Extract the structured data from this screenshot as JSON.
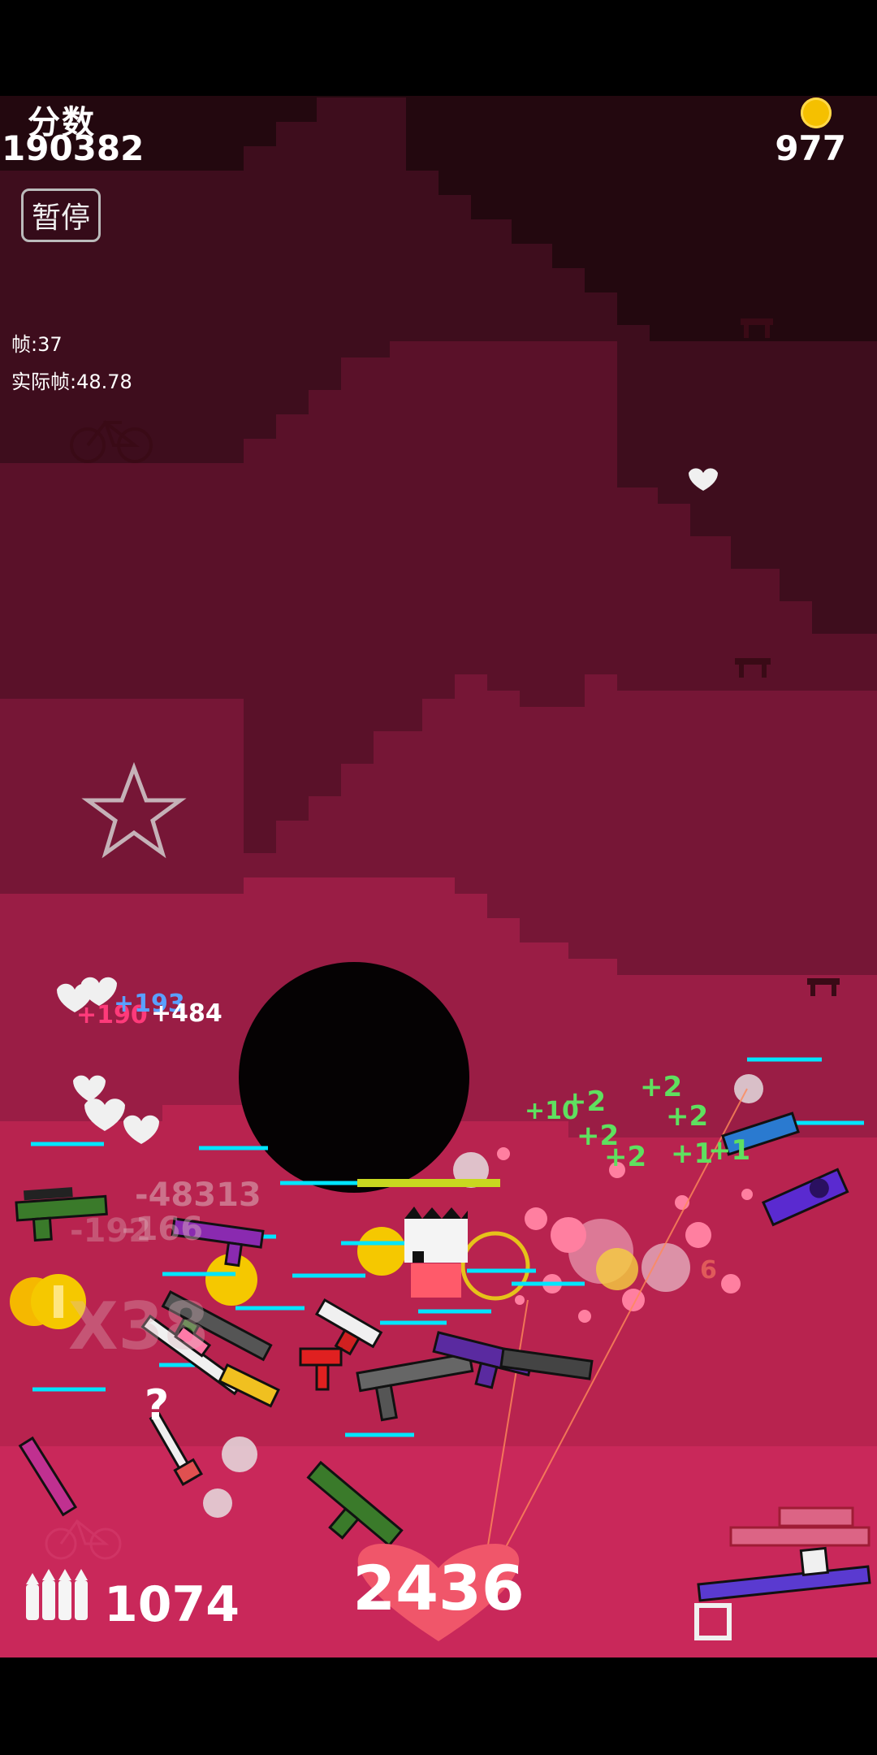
{
  "hud": {
    "score_label": "分数",
    "score_value": "190382",
    "coin_value": "977",
    "pause_label": "暂停",
    "fps_label": "帧:37",
    "real_fps_label": "实际帧:48.78",
    "ammo_value": "1074",
    "health_value": "2436"
  },
  "floating_numbers": {
    "pink_190": "+190",
    "blue_193": "+193",
    "white_484": "+484",
    "damage_1": "-48313",
    "damage_2": "-166",
    "damage_3": "-192",
    "combo": "X38",
    "plus_10": "+10",
    "plus_2_a": "+2",
    "plus_2_b": "+2",
    "plus_2_c": "+2",
    "plus_2_d": "+2",
    "plus_2_e": "+2",
    "plus_1_a": "+1",
    "plus_1_b": "+1",
    "red_6": "6",
    "question": "?"
  },
  "icons": [
    "coin-icon",
    "bullets-icon",
    "heart-icon",
    "bicycle-icon",
    "star-icon",
    "bench-icon"
  ],
  "colors": {
    "accent_heart": "#f0566a",
    "coin": "#f5c000",
    "health_bar": "#00e5ff",
    "green_text": "#5fe05f"
  }
}
